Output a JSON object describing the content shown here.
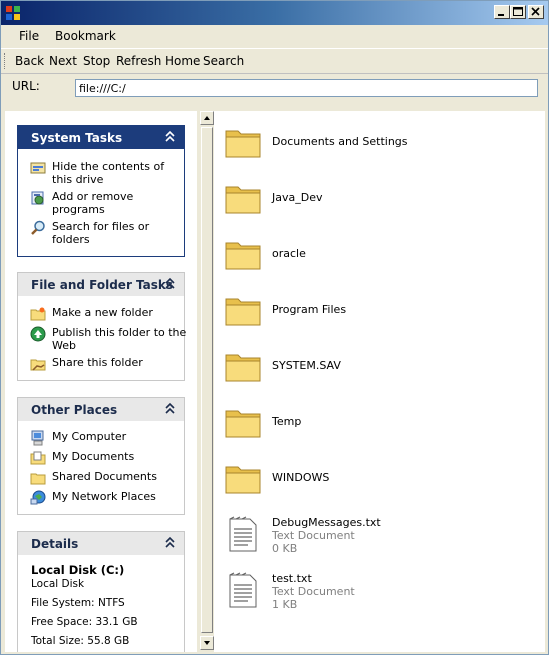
{
  "menu": [
    "File",
    "Bookmark"
  ],
  "toolbar": [
    "Back",
    "Next",
    "Stop",
    "Refresh",
    "Home",
    "Search"
  ],
  "url": {
    "label": "URL:",
    "value": "file:///C:/"
  },
  "panels": {
    "system_tasks": {
      "title": "System Tasks",
      "items": [
        [
          "Hide the contents of",
          "this drive"
        ],
        [
          "Add or remove",
          "programs"
        ],
        [
          "Search for files or",
          "folders"
        ]
      ]
    },
    "file_folder_tasks": {
      "title": "File and Folder Tasks",
      "items": [
        [
          "Make a new folder",
          ""
        ],
        [
          "Publish this folder to the",
          "Web"
        ],
        [
          "Share this folder",
          ""
        ]
      ]
    },
    "other_places": {
      "title": "Other Places",
      "items": [
        "My Computer",
        "My Documents",
        "Shared Documents",
        "My Network Places"
      ]
    },
    "details": {
      "title": "Details",
      "name": "Local Disk (C:)",
      "type": "Local Disk",
      "file_system": "File System: NTFS",
      "free_space": "Free Space: 33.1 GB",
      "total_size": "Total Size: 55.8 GB"
    }
  },
  "files": [
    {
      "name": "Documents and Settings",
      "kind": "folder"
    },
    {
      "name": "Java_Dev",
      "kind": "folder"
    },
    {
      "name": "oracle",
      "kind": "folder"
    },
    {
      "name": "Program Files",
      "kind": "folder"
    },
    {
      "name": "SYSTEM.SAV",
      "kind": "folder"
    },
    {
      "name": "Temp",
      "kind": "folder"
    },
    {
      "name": "WINDOWS",
      "kind": "folder"
    },
    {
      "name": "DebugMessages.txt",
      "kind": "text",
      "type": "Text Document",
      "size": "0 KB"
    },
    {
      "name": "test.txt",
      "kind": "text",
      "type": "Text Document",
      "size": "1 KB"
    }
  ],
  "colors": {
    "panel_dark": "#1c3c7c",
    "title_start": "#0a246a",
    "title_end": "#a6caf0"
  }
}
